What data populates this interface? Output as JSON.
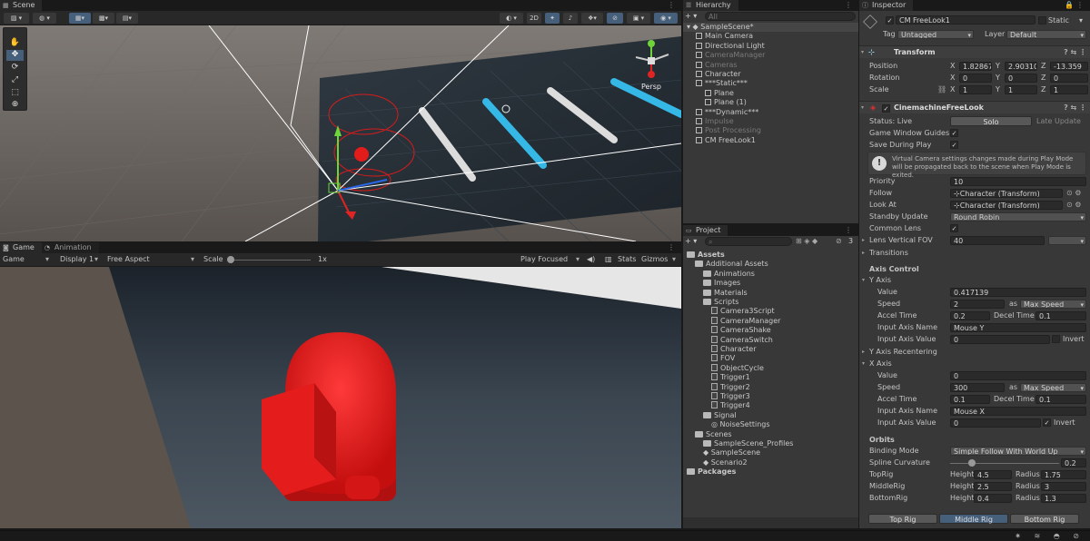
{
  "scene": {
    "tab": "Scene",
    "toolbar": {
      "mode_2d": "2D"
    },
    "persp_label": "Persp"
  },
  "game": {
    "tab_game": "Game",
    "tab_animation": "Animation",
    "toolbar": {
      "view": "Game",
      "display": "Display 1",
      "aspect": "Free Aspect",
      "scale_label": "Scale",
      "scale_value": "1x",
      "play_mode": "Play Focused",
      "stats": "Stats",
      "gizmos": "Gizmos"
    }
  },
  "hierarchy": {
    "tab": "Hierarchy",
    "search_placeholder": "All",
    "items": [
      {
        "label": "SampleScene*",
        "depth": 0,
        "kind": "scene",
        "dim": false
      },
      {
        "label": "Main Camera",
        "depth": 1,
        "kind": "cube",
        "dim": false
      },
      {
        "label": "Directional Light",
        "depth": 1,
        "kind": "cube",
        "dim": false
      },
      {
        "label": "CameraManager",
        "depth": 1,
        "kind": "cube",
        "dim": true
      },
      {
        "label": "Cameras",
        "depth": 1,
        "kind": "cube",
        "dim": true
      },
      {
        "label": "Character",
        "depth": 1,
        "kind": "cube",
        "dim": false
      },
      {
        "label": "***Static***",
        "depth": 1,
        "kind": "cube",
        "dim": false
      },
      {
        "label": "Plane",
        "depth": 2,
        "kind": "cube",
        "dim": false
      },
      {
        "label": "Plane (1)",
        "depth": 2,
        "kind": "cube",
        "dim": false
      },
      {
        "label": "***Dynamic***",
        "depth": 1,
        "kind": "cube",
        "dim": false
      },
      {
        "label": "Impulse",
        "depth": 1,
        "kind": "cube",
        "dim": true
      },
      {
        "label": "Post Processing",
        "depth": 1,
        "kind": "cube",
        "dim": true
      },
      {
        "label": "CM FreeLook1",
        "depth": 1,
        "kind": "cube",
        "dim": false
      }
    ]
  },
  "project": {
    "tab": "Project",
    "badge": "3",
    "items": [
      {
        "label": "Assets",
        "depth": 0,
        "kind": "folder",
        "bold": true
      },
      {
        "label": "Additional Assets",
        "depth": 1,
        "kind": "folder"
      },
      {
        "label": "Animations",
        "depth": 2,
        "kind": "folder"
      },
      {
        "label": "Images",
        "depth": 2,
        "kind": "folder"
      },
      {
        "label": "Materials",
        "depth": 2,
        "kind": "folder"
      },
      {
        "label": "Scripts",
        "depth": 2,
        "kind": "folder"
      },
      {
        "label": "Camera3Script",
        "depth": 3,
        "kind": "script"
      },
      {
        "label": "CameraManager",
        "depth": 3,
        "kind": "script"
      },
      {
        "label": "CameraShake",
        "depth": 3,
        "kind": "script"
      },
      {
        "label": "CameraSwitch",
        "depth": 3,
        "kind": "script"
      },
      {
        "label": "Character",
        "depth": 3,
        "kind": "script"
      },
      {
        "label": "FOV",
        "depth": 3,
        "kind": "script"
      },
      {
        "label": "ObjectCycle",
        "depth": 3,
        "kind": "script"
      },
      {
        "label": "Trigger1",
        "depth": 3,
        "kind": "script"
      },
      {
        "label": "Trigger2",
        "depth": 3,
        "kind": "script"
      },
      {
        "label": "Trigger3",
        "depth": 3,
        "kind": "script"
      },
      {
        "label": "Trigger4",
        "depth": 3,
        "kind": "script"
      },
      {
        "label": "Signal",
        "depth": 2,
        "kind": "folder"
      },
      {
        "label": "NoiseSettings",
        "depth": 3,
        "kind": "asset"
      },
      {
        "label": "Scenes",
        "depth": 1,
        "kind": "folder"
      },
      {
        "label": "SampleScene_Profiles",
        "depth": 2,
        "kind": "folder"
      },
      {
        "label": "SampleScene",
        "depth": 2,
        "kind": "unity"
      },
      {
        "label": "Scenario2",
        "depth": 2,
        "kind": "unity"
      },
      {
        "label": "Packages",
        "depth": 0,
        "kind": "folder",
        "bold": true
      }
    ]
  },
  "inspector": {
    "tab": "Inspector",
    "object_name": "CM FreeLook1",
    "static_label": "Static",
    "tag_label": "Tag",
    "tag_value": "Untagged",
    "layer_label": "Layer",
    "layer_value": "Default",
    "transform": {
      "title": "Transform",
      "position_label": "Position",
      "rotation_label": "Rotation",
      "scale_label": "Scale",
      "px": "1.82867",
      "py": "2.90310",
      "pz": "-13.359",
      "rx": "0",
      "ry": "0",
      "rz": "0",
      "sx": "1",
      "sy": "1",
      "sz": "1",
      "x": "X",
      "y": "Y",
      "z": "Z"
    },
    "freelook": {
      "title": "CinemachineFreeLook",
      "status_label": "Status: Live",
      "solo": "Solo",
      "late_update": "Late Update",
      "guides_label": "Game Window Guides",
      "save_label": "Save During Play",
      "info": "Virtual Camera settings changes made during Play Mode will be propagated back to the scene when Play Mode is exited.",
      "priority_label": "Priority",
      "priority": "10",
      "follow_label": "Follow",
      "follow": "Character (Transform)",
      "lookat_label": "Look At",
      "lookat": "Character (Transform)",
      "standby_label": "Standby Update",
      "standby": "Round Robin",
      "common_lens_label": "Common Lens",
      "fov_label": "Lens Vertical FOV",
      "fov": "40",
      "transitions_label": "Transitions",
      "axis_control": "Axis Control",
      "y_axis": "Y Axis",
      "value_label": "Value",
      "y_value": "0.417139",
      "speed_label": "Speed",
      "y_speed": "2",
      "as": "as",
      "y_speed_mode": "Max Speed",
      "accel_label": "Accel Time",
      "y_accel": "0.2",
      "decel_label": "Decel Time",
      "y_decel": "0.1",
      "input_name_label": "Input Axis Name",
      "y_input": "Mouse Y",
      "input_value_label": "Input Axis Value",
      "y_input_value": "0",
      "invert_label": "Invert",
      "y_recenter": "Y Axis Recentering",
      "x_axis": "X Axis",
      "x_value": "0",
      "x_speed": "300",
      "x_speed_mode": "Max Speed",
      "x_accel": "0.1",
      "x_decel": "0.1",
      "x_input": "Mouse X",
      "x_input_value": "0",
      "orbits": "Orbits",
      "binding_label": "Binding Mode",
      "binding": "Simple Follow With World Up",
      "spline_label": "Spline Curvature",
      "spline": "0.2",
      "spline_fraction": 0.2,
      "top_label": "TopRig",
      "mid_label": "MiddleRig",
      "bot_label": "BottomRig",
      "height_label": "Height",
      "radius_label": "Radius",
      "top_h": "4.5",
      "top_r": "1.75",
      "mid_h": "2.5",
      "mid_r": "3",
      "bot_h": "0.4",
      "bot_r": "1.3",
      "rig_top": "Top Rig",
      "rig_mid": "Middle Rig",
      "rig_bot": "Bottom Rig"
    }
  }
}
